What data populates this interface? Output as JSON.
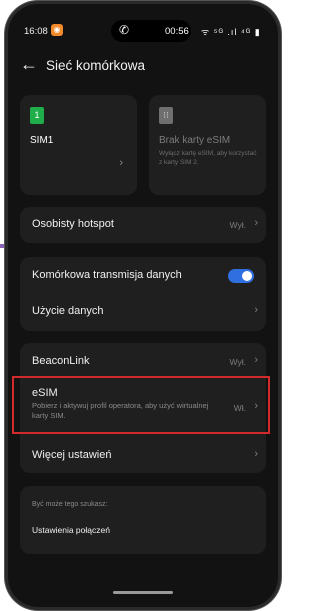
{
  "status_bar": {
    "time": "16:08",
    "call_time": "00:56",
    "icons": "ᯤ ⁵ᴳ .ıl ⁴ᴳ ▮"
  },
  "header": {
    "back_icon": "arrow-left-icon",
    "title": "Sieć komórkowa"
  },
  "sim_cards": [
    {
      "icon_text": "1",
      "label": "SIM1",
      "description": ""
    },
    {
      "icon_text": "⁝⁝",
      "label": "Brak karty eSIM",
      "description": "Wyłącz kartę eSIM, aby korzystać z karty SIM 2."
    }
  ],
  "hotspot": {
    "label": "Osobisty hotspot",
    "value": "Wył."
  },
  "data_group": {
    "mobile_data": {
      "label": "Komórkowa transmisja danych",
      "enabled": true
    },
    "data_usage": {
      "label": "Użycie danych"
    }
  },
  "beacon_group": {
    "beaconlink": {
      "label": "BeaconLink",
      "value": "Wył."
    },
    "esim": {
      "label": "eSIM",
      "description": "Pobierz i aktywuj profil operatora, aby użyć wirtualnej karty SIM.",
      "value": "Wł."
    },
    "more": {
      "label": "Więcej ustawień"
    }
  },
  "suggestions": {
    "title": "Być może tego szukasz:",
    "item": "Ustawienia połączeń"
  },
  "colors": {
    "accent": "#2f6fe0",
    "highlight": "#d22b2b",
    "sim_green": "#1fae4a"
  }
}
